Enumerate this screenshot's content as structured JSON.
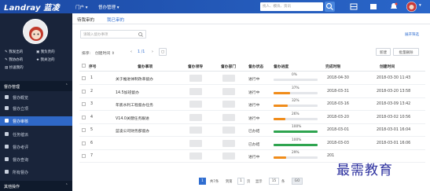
{
  "brand": "Landray 蓝凌",
  "topnav": {
    "portal": "门户 ▾",
    "task_mgmt": "督办管理 ▾"
  },
  "search": {
    "placeholder": "找人、模块、资讯"
  },
  "colors": {
    "topbar": "#1c4aa5",
    "sidebar": "#19243a",
    "active": "#2f68c7",
    "link": "#2f6dd0"
  },
  "sidebar": {
    "quick": [
      "我发出的",
      "我负责的",
      "我协办的",
      "我关注的",
      "抄送我的"
    ],
    "section1": "督办管理",
    "items": [
      "督办概览",
      "督办立项",
      "督办审核",
      "任务催派",
      "督办考评",
      "督办查询",
      "所有督办"
    ],
    "active_index": 2,
    "section2": "其他操作"
  },
  "tabs": {
    "pending": "待我审的",
    "done": "我已审的"
  },
  "filter": {
    "placeholder": "请输入督办事项",
    "more": "展开筛选"
  },
  "toolbar": {
    "sort_label": "排序:",
    "sort_value": "创建时间 ⇕",
    "page_info": "1 /1",
    "new_btn": "新建",
    "batch_delete_btn": "批量删除"
  },
  "table": {
    "headers": [
      "序号",
      "督办事项",
      "督办领导",
      "督办部门",
      "督办状态",
      "督办进度",
      "完成时限",
      "创建时间"
    ],
    "rows": [
      {
        "no": "1",
        "title": "关于推进体制改革督办",
        "status": "进行中",
        "progress": 0,
        "progress_label": "0%",
        "deadline": "2018-04-30",
        "created": "2018-03-30 11:43"
      },
      {
        "no": "2",
        "title": "14.5加班督办",
        "status": "进行中",
        "progress": 37,
        "progress_label": "37%",
        "deadline": "2018-03-31",
        "created": "2018-03-20 13:58"
      },
      {
        "no": "3",
        "title": "年底水利工程督办任务",
        "status": "进行中",
        "progress": 32,
        "progress_label": "32%",
        "deadline": "2018-03-16",
        "created": "2018-03-09 13:42"
      },
      {
        "no": "4",
        "title": "V14.0关键任务跟进",
        "status": "进行中",
        "progress": 26,
        "progress_label": "26%",
        "deadline": "2018-03-20",
        "created": "2018-03-02 10:56"
      },
      {
        "no": "5",
        "title": "蓝凌公司财务部督办",
        "status": "已办结",
        "progress": 100,
        "progress_label": "100%",
        "deadline": "2018-03-01",
        "created": "2018-03-01 16:04"
      },
      {
        "no": "6",
        "title": "",
        "status": "已办结",
        "progress": 100,
        "progress_label": "100%",
        "deadline": "2018-03-03",
        "created": "2018-03-01 16:06"
      },
      {
        "no": "7",
        "title": "",
        "status": "进行中",
        "progress": 29,
        "progress_label": "29%",
        "deadline": "201",
        "created": ""
      }
    ]
  },
  "pager": {
    "page": "1",
    "total": "共7条",
    "goto": "到第",
    "page_input": "1",
    "page_unit": "页",
    "size_label": "显示",
    "size": "15",
    "size_unit": "条",
    "go": "GO"
  },
  "watermark": "最需教育"
}
